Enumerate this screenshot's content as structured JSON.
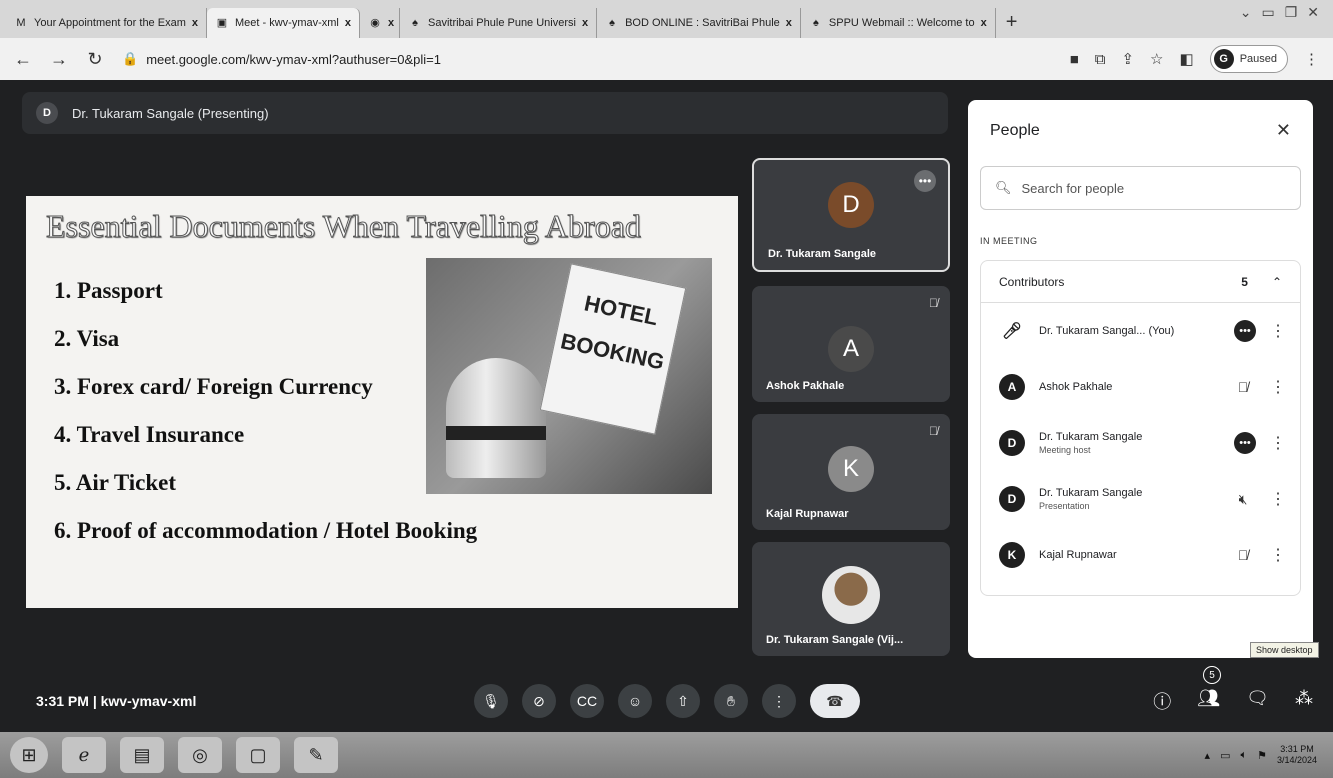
{
  "browser": {
    "tabs": [
      {
        "favicon": "M",
        "title": "Your Appointment for the Exam",
        "close": "x"
      },
      {
        "favicon": "▣",
        "title": "Meet - kwv-ymav-xml",
        "close": "x"
      },
      {
        "favicon": "◉",
        "title": "",
        "close": "x"
      },
      {
        "favicon": "♠",
        "title": "Savitribai Phule Pune Universi",
        "close": "x"
      },
      {
        "favicon": "♠",
        "title": "BOD ONLINE : SavitriBai Phule",
        "close": "x"
      },
      {
        "favicon": "♠",
        "title": "SPPU Webmail :: Welcome to",
        "close": "x"
      }
    ],
    "new_tab": "+",
    "url": "meet.google.com/kwv-ymav-xml?authuser=0&pli=1",
    "profile_letter": "G",
    "profile_status": "Paused"
  },
  "meet": {
    "presenter_badge": "D",
    "presenter_label": "Dr. Tukaram Sangale (Presenting)",
    "slide": {
      "title": "Essential Documents When Travelling Abroad",
      "items": [
        "1. Passport",
        "2. Visa",
        "3. Forex card/ Foreign Currency",
        "4. Travel Insurance",
        "5. Air Ticket",
        "6. Proof of accommodation / Hotel Booking"
      ],
      "image_text": "HOTEL BOOKING"
    },
    "tiles": [
      {
        "letter": "D",
        "name": "Dr. Tukaram Sangale",
        "color": "#7a4b2a"
      },
      {
        "letter": "A",
        "name": "Ashok Pakhale",
        "color": "#4a4a4a"
      },
      {
        "letter": "K",
        "name": "Kajal Rupnawar",
        "color": "#8a8a8a"
      },
      {
        "letter": "",
        "name": "Dr. Tukaram Sangale (Vij..."
      }
    ],
    "meeting_time": "3:31 PM",
    "meeting_code": "kwv-ymav-xml",
    "separator": "|",
    "people_count": "5",
    "show_desktop_tooltip": "Show desktop"
  },
  "people_panel": {
    "title": "People",
    "search_placeholder": "Search for people",
    "in_meeting_label": "IN MEETING",
    "contributors_label": "Contributors",
    "contributors_count": "5",
    "rows": [
      {
        "name": "Dr. Tukaram Sangal...",
        "tag": "(You)",
        "sub": "",
        "avatar": ""
      },
      {
        "name": "Ashok Pakhale",
        "tag": "",
        "sub": "",
        "avatar": "A"
      },
      {
        "name": "Dr. Tukaram Sangale",
        "tag": "",
        "sub": "Meeting host",
        "avatar": "D"
      },
      {
        "name": "Dr. Tukaram Sangale",
        "tag": "",
        "sub": "Presentation",
        "avatar": "D"
      },
      {
        "name": "Kajal Rupnawar",
        "tag": "",
        "sub": "",
        "avatar": "K"
      }
    ]
  },
  "taskbar": {
    "clock_time": "3:31 PM",
    "clock_date": "3/14/2024"
  }
}
